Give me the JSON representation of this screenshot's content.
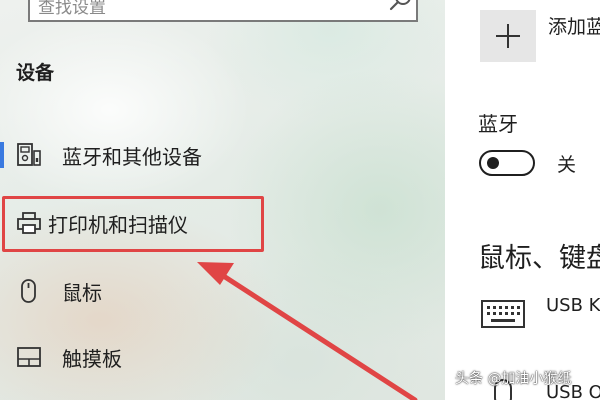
{
  "search": {
    "placeholder": "查找设置"
  },
  "section_title": "设备",
  "nav": {
    "items": [
      {
        "label": "蓝牙和其他设备",
        "icon": "bluetooth-devices-icon",
        "selected": true
      },
      {
        "label": "打印机和扫描仪",
        "icon": "printer-icon",
        "highlighted": true
      },
      {
        "label": "鼠标",
        "icon": "mouse-icon"
      },
      {
        "label": "触摸板",
        "icon": "touchpad-icon"
      }
    ]
  },
  "main": {
    "add_device_label": "添加蓝",
    "bluetooth": {
      "title": "蓝牙",
      "state": "关"
    },
    "mouse_keyboard_heading": "鼠标、键盘",
    "devices": [
      {
        "name": "USB K",
        "icon": "keyboard-icon"
      },
      {
        "name": "USB O",
        "icon": "mouse-icon"
      }
    ]
  },
  "watermark": "头条 @加油小猴纸",
  "colors": {
    "accent": "#3a7ae0",
    "annotation": "#e04545"
  }
}
